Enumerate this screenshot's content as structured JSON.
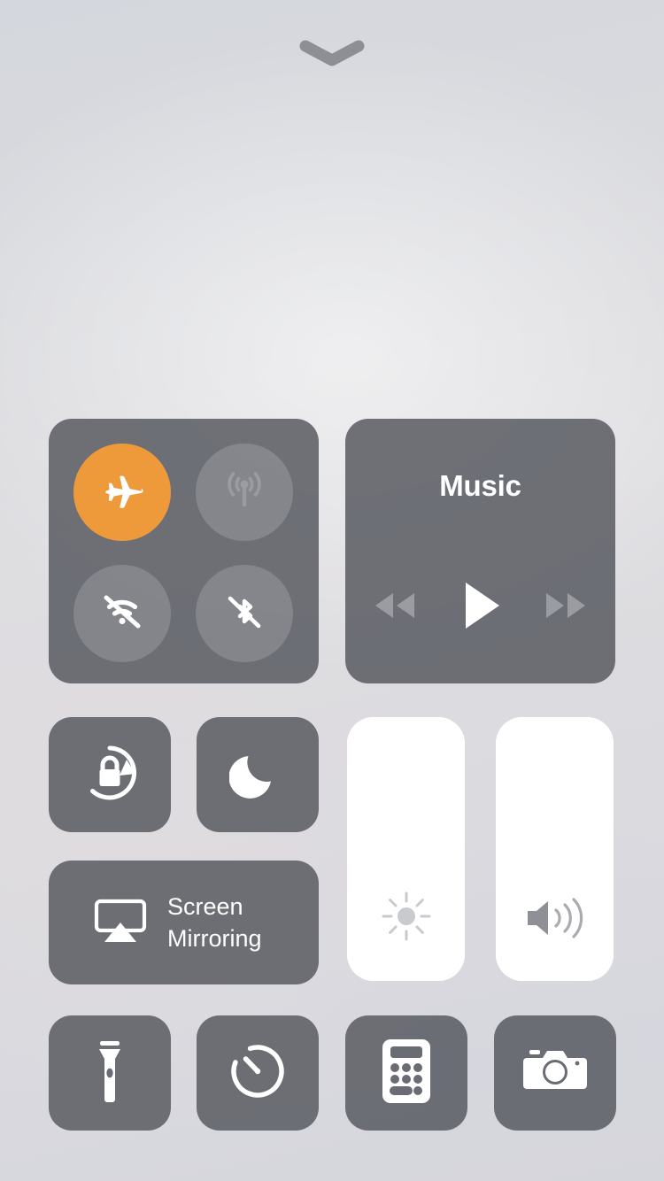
{
  "screen": {
    "name": "Control Center",
    "background_color": "#d8dade",
    "module_color": "#5c5e65",
    "accent_color": "#ee9a3b",
    "slider_color": "#ffffff"
  },
  "grabber": {
    "icon": "chevron-down-icon",
    "color": "#8d8f95"
  },
  "connectivity": {
    "name": "connectivity-module",
    "toggles": [
      {
        "id": "airplane-mode",
        "icon": "airplane-icon",
        "label": "Airplane Mode",
        "state": "on",
        "active_color": "#ee9a3b"
      },
      {
        "id": "cellular-data",
        "icon": "cellular-icon",
        "label": "Cellular Data",
        "state": "off"
      },
      {
        "id": "wifi",
        "icon": "wifi-off-icon",
        "label": "Wi-Fi",
        "state": "off"
      },
      {
        "id": "bluetooth",
        "icon": "bluetooth-off-icon",
        "label": "Bluetooth",
        "state": "off"
      }
    ]
  },
  "music": {
    "name": "music-module",
    "title": "Music",
    "controls": [
      {
        "id": "rewind",
        "icon": "rewind-icon",
        "label": "Rewind",
        "state": "dimmed"
      },
      {
        "id": "play",
        "icon": "play-icon",
        "label": "Play",
        "state": "active"
      },
      {
        "id": "forward",
        "icon": "forward-icon",
        "label": "Fast Forward",
        "state": "dimmed"
      }
    ]
  },
  "toggles_row": [
    {
      "id": "rotation-lock",
      "icon": "rotation-lock-icon",
      "label": "Rotation Lock",
      "state": "off"
    },
    {
      "id": "do-not-disturb",
      "icon": "moon-icon",
      "label": "Do Not Disturb",
      "state": "off"
    }
  ],
  "screen_mirroring": {
    "name": "screen-mirroring-button",
    "icon": "airplay-icon",
    "label": "Screen\nMirroring"
  },
  "sliders": [
    {
      "id": "brightness",
      "icon": "brightness-icon",
      "label": "Brightness",
      "value": 100,
      "unit": "%"
    },
    {
      "id": "volume",
      "icon": "volume-icon",
      "label": "Volume",
      "value": 100,
      "unit": "%"
    }
  ],
  "shortcuts": [
    {
      "id": "flashlight",
      "icon": "flashlight-icon",
      "label": "Flashlight"
    },
    {
      "id": "timer",
      "icon": "timer-icon",
      "label": "Timer"
    },
    {
      "id": "calculator",
      "icon": "calculator-icon",
      "label": "Calculator"
    },
    {
      "id": "camera",
      "icon": "camera-icon",
      "label": "Camera"
    }
  ]
}
